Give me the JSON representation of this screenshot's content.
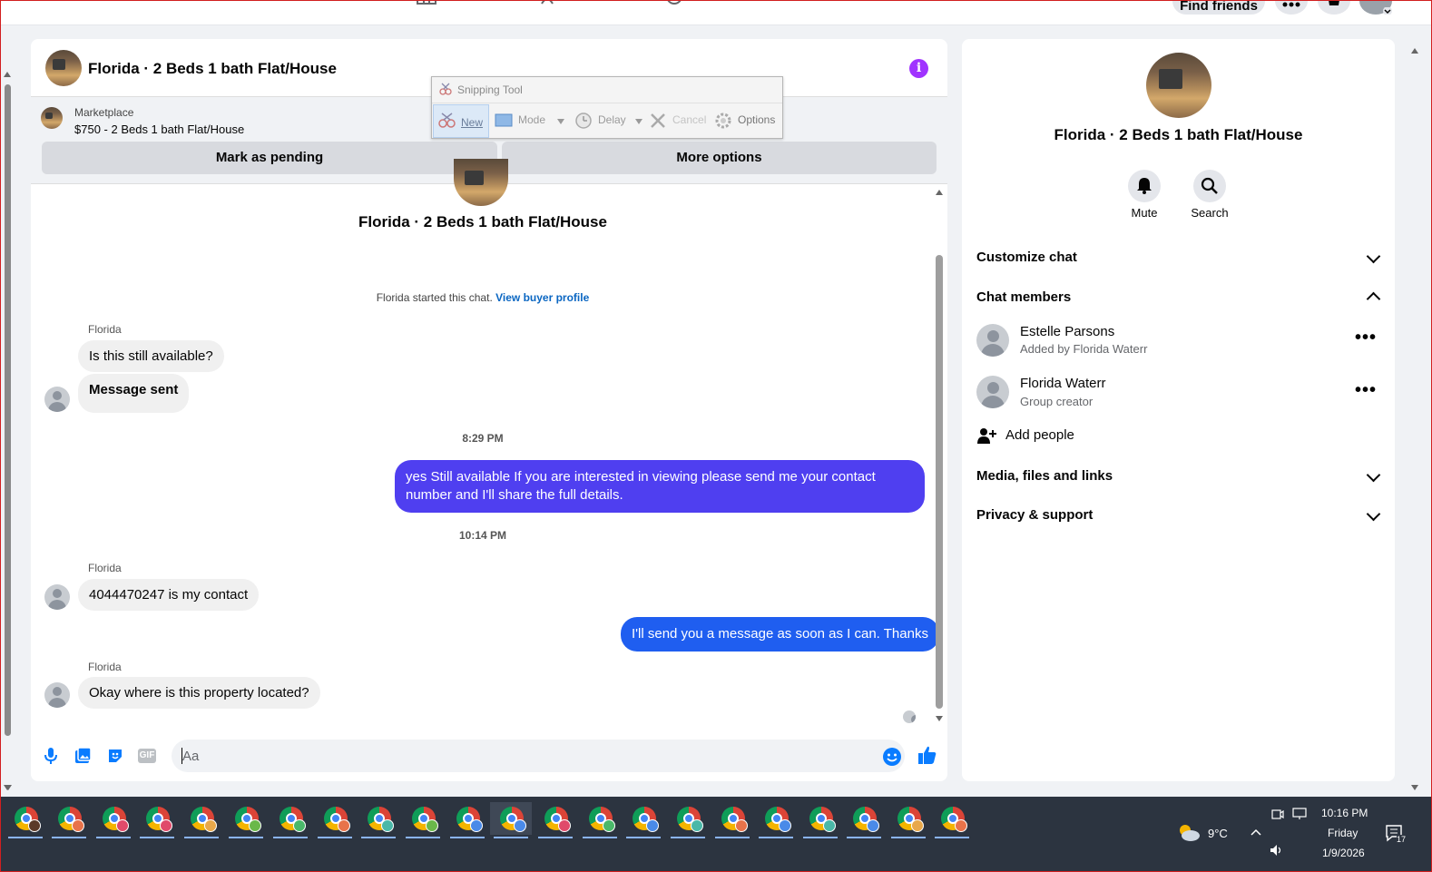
{
  "topnav": {
    "find_friends": "Find friends"
  },
  "chat": {
    "title": "Florida · 2 Beds 1 bath Flat/House",
    "marketplace": {
      "label": "Marketplace",
      "listing": "$750 - 2 Beds 1 bath Flat/House",
      "mark_pending": "Mark as pending",
      "more_options": "More options"
    },
    "center_title": "Florida · 2 Beds 1 bath Flat/House",
    "started_text": "Florida started this chat.",
    "view_profile": "View buyer profile",
    "messages": [
      {
        "sender": "Florida",
        "text": "Is this still available?"
      },
      {
        "text": "Message sent"
      },
      {
        "time": "8:29 PM"
      },
      {
        "text": "yes Still available If you are interested in viewing please send me your contact number and I'll share the full details."
      },
      {
        "time": "10:14 PM"
      },
      {
        "sender": "Florida",
        "text": "4044470247 is my contact"
      },
      {
        "text": "I'll send you a message as soon as I can. Thanks"
      },
      {
        "sender": "Florida",
        "text": "Okay where is this property located?"
      }
    ],
    "composer_placeholder": "Aa",
    "gif_label": "GIF"
  },
  "snipping_tool": {
    "title": "Snipping Tool",
    "new": "New",
    "mode": "Mode",
    "delay": "Delay",
    "cancel": "Cancel",
    "options": "Options"
  },
  "side": {
    "title": "Florida · 2 Beds 1 bath Flat/House",
    "mute": "Mute",
    "search": "Search",
    "customize": "Customize chat",
    "members_heading": "Chat members",
    "members": [
      {
        "name": "Estelle Parsons",
        "sub": "Added by Florida Waterr"
      },
      {
        "name": "Florida Waterr",
        "sub": "Group creator"
      }
    ],
    "add_people": "Add people",
    "media": "Media, files and links",
    "privacy": "Privacy & support"
  },
  "taskbar": {
    "temperature": "9°C",
    "time": "10:16 PM",
    "day": "Friday",
    "date": "1/9/2026",
    "notifications": "17"
  },
  "colors": {
    "outgoing_purple": "#4f3ff0",
    "outgoing_blue": "#1f5ef0",
    "info_purple": "#a033ff",
    "messenger_blue": "#0a7cff"
  }
}
